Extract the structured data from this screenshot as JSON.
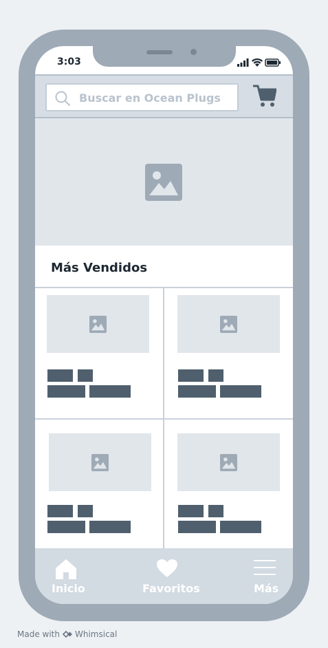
{
  "status_bar": {
    "time": "3:03"
  },
  "search": {
    "placeholder": "Buscar en Ocean Plugs"
  },
  "section": {
    "title": "Más Vendidos"
  },
  "bottom_nav": {
    "items": [
      {
        "label": "Inicio",
        "icon": "home-icon"
      },
      {
        "label": "Favoritos",
        "icon": "heart-icon"
      },
      {
        "label": "Más",
        "icon": "hamburger-menu-icon"
      }
    ]
  },
  "footer": {
    "made_with": "Made with",
    "brand": "Whimsical"
  },
  "colors": {
    "frame": "#9eaab6",
    "placeholder_fill": "#e1e6eb",
    "text_bar": "#4f5f6d",
    "tab_bar": "#d2dae2"
  }
}
